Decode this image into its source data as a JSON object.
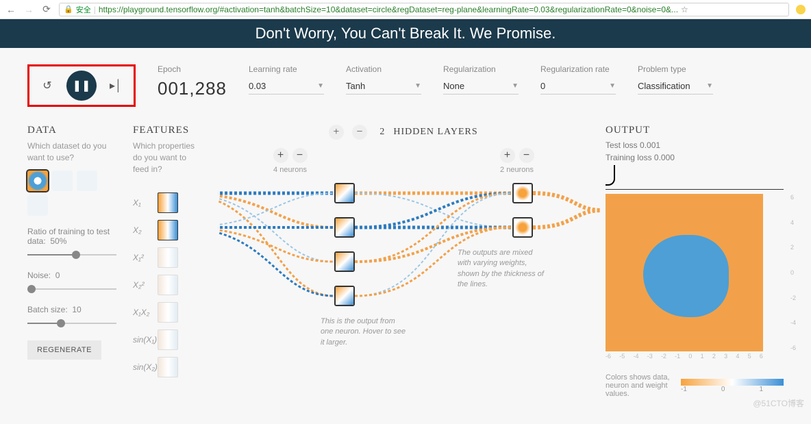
{
  "browser": {
    "secure_label": "安全",
    "url": "https://playground.tensorflow.org/#activation=tanh&batchSize=10&dataset=circle&regDataset=reg-plane&learningRate=0.03&regularizationRate=0&noise=0&..."
  },
  "banner": {
    "title": "Don't Worry, You Can't Break It. We Promise."
  },
  "controls": {
    "epoch_label": "Epoch",
    "epoch_value": "001,288",
    "learning_rate_label": "Learning rate",
    "learning_rate_value": "0.03",
    "activation_label": "Activation",
    "activation_value": "Tanh",
    "regularization_label": "Regularization",
    "regularization_value": "None",
    "reg_rate_label": "Regularization rate",
    "reg_rate_value": "0",
    "problem_label": "Problem type",
    "problem_value": "Classification"
  },
  "data": {
    "title": "DATA",
    "subtitle": "Which dataset do you want to use?",
    "ratio_label": "Ratio of training to test data:",
    "ratio_value": "50%",
    "noise_label": "Noise:",
    "noise_value": "0",
    "batch_label": "Batch size:",
    "batch_value": "10",
    "regenerate": "REGENERATE"
  },
  "features": {
    "title": "FEATURES",
    "subtitle": "Which properties do you want to feed in?",
    "items": [
      "X₁",
      "X₂",
      "X₁²",
      "X₂²",
      "X₁X₂",
      "sin(X₁)",
      "sin(X₂)"
    ]
  },
  "network": {
    "header": "HIDDEN LAYERS",
    "count": "2",
    "layer1_neurons": "4 neurons",
    "layer2_neurons": "2 neurons",
    "callout1": "This is the output from one neuron. Hover to see it larger.",
    "callout2": "The outputs are mixed with varying weights, shown by the thickness of the lines."
  },
  "output": {
    "title": "OUTPUT",
    "test_loss": "Test loss 0.001",
    "train_loss": "Training loss 0.000",
    "axis_ticks": [
      "-6",
      "-5",
      "-4",
      "-3",
      "-2",
      "-1",
      "0",
      "1",
      "2",
      "3",
      "4",
      "5",
      "6"
    ],
    "legend_text": "Colors shows data, neuron and weight values.",
    "legend_ticks": [
      "-1",
      "0",
      "1"
    ]
  },
  "watermark": "@51CTO博客"
}
